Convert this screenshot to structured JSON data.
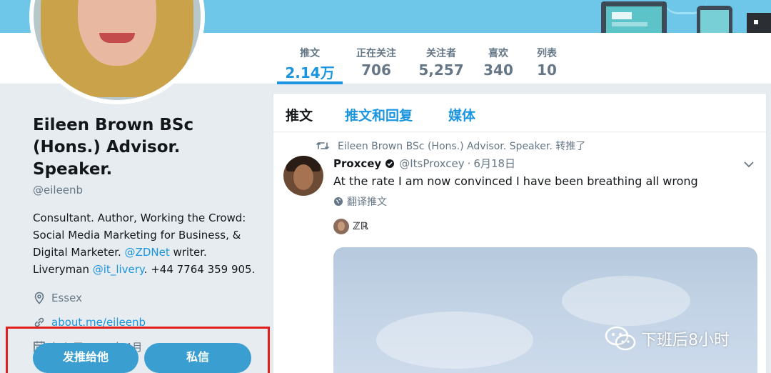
{
  "stats": [
    {
      "label": "推文",
      "value": "2.14万",
      "active": true
    },
    {
      "label": "正在关注",
      "value": "706"
    },
    {
      "label": "关注者",
      "value": "5,257"
    },
    {
      "label": "喜欢",
      "value": "340"
    },
    {
      "label": "列表",
      "value": "10"
    }
  ],
  "profile": {
    "name": "Eileen Brown BSc (Hons.) Advisor. Speaker.",
    "handle": "@eileenb",
    "bio_part1": "Consultant. Author, Working the Crowd: Social Media Marketing for Business, & Digital Marketer. ",
    "bio_link1": "@ZDNet",
    "bio_part2": " writer. Liveryman ",
    "bio_link2": "@it_livery",
    "bio_part3": ". +44 7764 359 905.",
    "location": "Essex",
    "website": "about.me/eileenb",
    "joined": "加入于 2007年4月"
  },
  "buttons": {
    "tweet_to": "发推给他",
    "message": "私信"
  },
  "tabs": [
    {
      "label": "推文",
      "active": true
    },
    {
      "label": "推文和回复"
    },
    {
      "label": "媒体"
    }
  ],
  "tweet": {
    "retweet_context": "Eileen Brown BSc (Hons.) Advisor. Speaker. 转推了",
    "author_name": "Proxcey",
    "author_handle": "@ItsProxcey",
    "separator": "·",
    "date": "6月18日",
    "text": "At the rate I am now convinced I have been breathing all wrong",
    "translate": "翻译推文",
    "tagged_user": "ℤℝ"
  },
  "watermark": "下班后8小时",
  "colors": {
    "accent": "#1b95e0",
    "button": "#3a9ed1",
    "highlight_box": "#e0201f",
    "banner": "#6ec6e8"
  },
  "icons": [
    "location-icon",
    "link-icon",
    "calendar-icon",
    "retweet-icon",
    "verified-icon",
    "chevron-down-icon",
    "globe-icon",
    "wechat-icon"
  ]
}
